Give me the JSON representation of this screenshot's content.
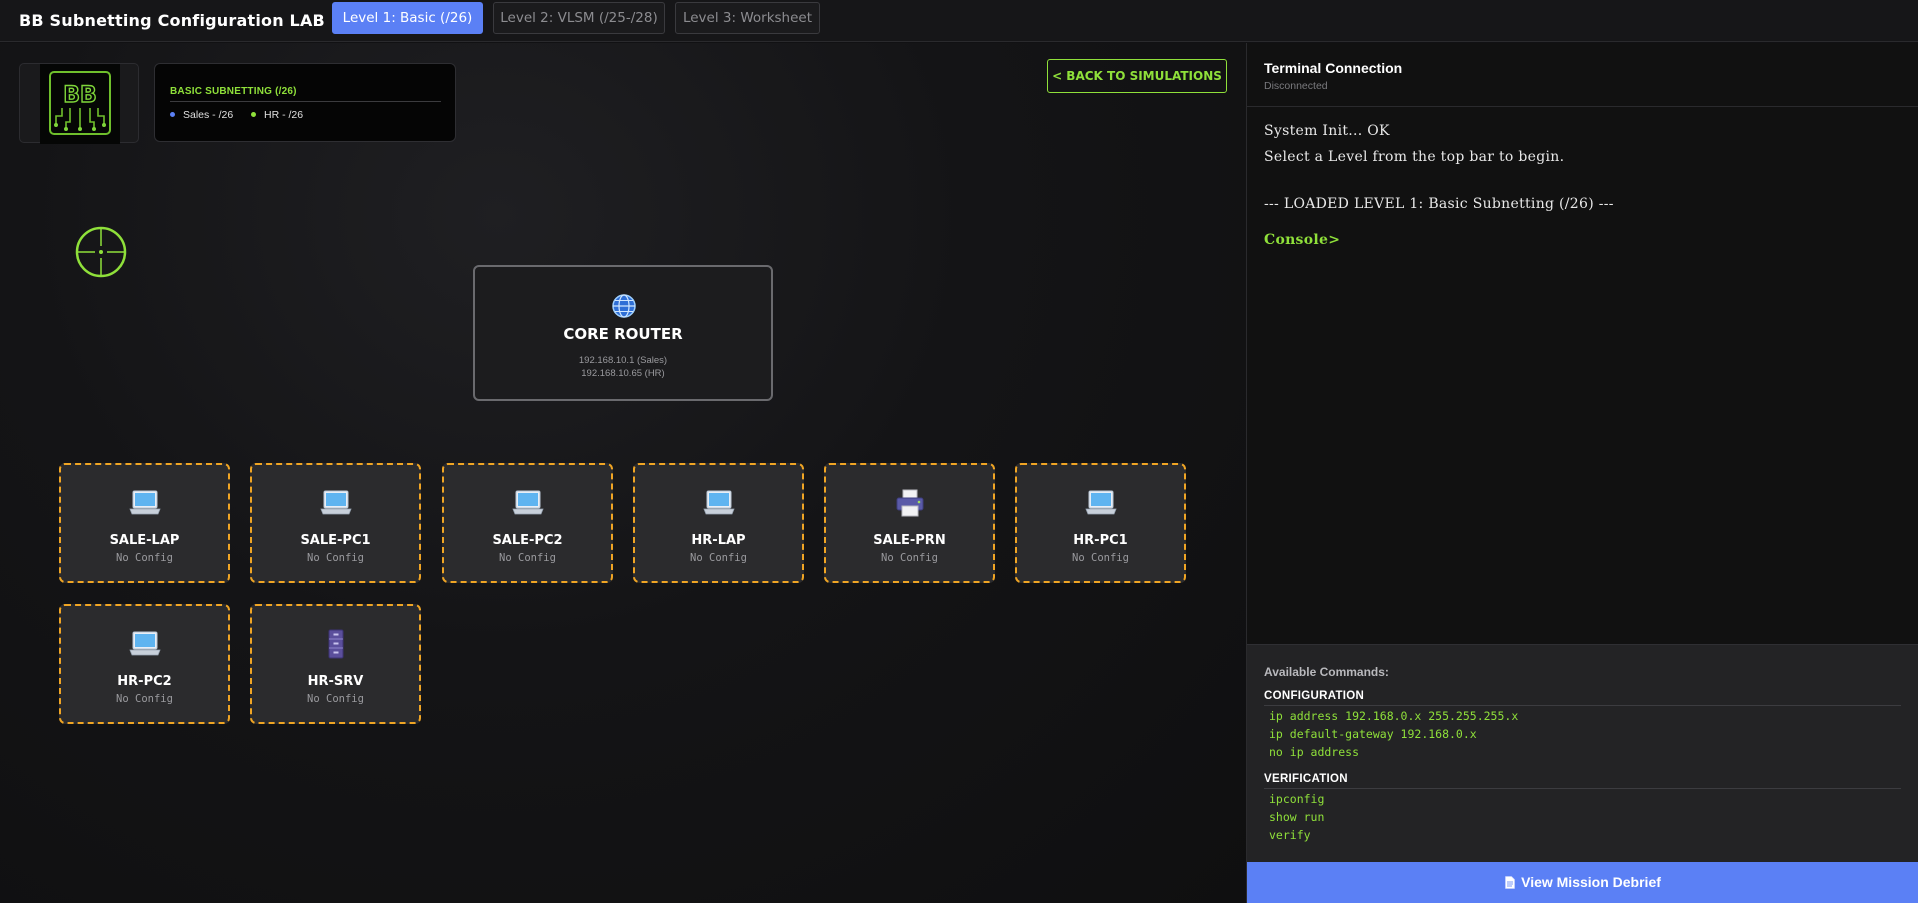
{
  "app": {
    "title": "BB Subnetting Configuration LAB"
  },
  "tabs": [
    {
      "label": "Level 1: Basic (/26)",
      "active": true
    },
    {
      "label": "Level 2: VLSM (/25-/28)",
      "active": false
    },
    {
      "label": "Level 3: Worksheet",
      "active": false
    }
  ],
  "logo": {
    "text": "BB"
  },
  "legend": {
    "title": "BASIC SUBNETTING (/26)",
    "items": [
      {
        "label": "Sales - /26",
        "color": "#5b80f5"
      },
      {
        "label": "HR - /26",
        "color": "#8fe03a"
      }
    ]
  },
  "back_button": {
    "label": "< BACK TO SIMULATIONS"
  },
  "router": {
    "icon": "globe-icon",
    "name": "CORE ROUTER",
    "ips": [
      "192.168.10.1 (Sales)",
      "192.168.10.65 (HR)"
    ]
  },
  "devices": [
    {
      "name": "SALE-LAP",
      "status": "No Config",
      "icon": "laptop-icon"
    },
    {
      "name": "SALE-PC1",
      "status": "No Config",
      "icon": "laptop-icon"
    },
    {
      "name": "SALE-PC2",
      "status": "No Config",
      "icon": "laptop-icon"
    },
    {
      "name": "HR-LAP",
      "status": "No Config",
      "icon": "laptop-icon"
    },
    {
      "name": "SALE-PRN",
      "status": "No Config",
      "icon": "printer-icon"
    },
    {
      "name": "HR-PC1",
      "status": "No Config",
      "icon": "laptop-icon"
    },
    {
      "name": "HR-PC2",
      "status": "No Config",
      "icon": "laptop-icon"
    },
    {
      "name": "HR-SRV",
      "status": "No Config",
      "icon": "server-icon"
    }
  ],
  "terminal": {
    "title": "Terminal Connection",
    "status": "Disconnected",
    "lines": [
      "System Init... OK",
      "Select a Level from the top bar to begin.",
      "--- LOADED LEVEL 1: Basic Subnetting (/26) ---"
    ],
    "prompt": "Console>"
  },
  "commands": {
    "heading": "Available Commands:",
    "sections": [
      {
        "title": "CONFIGURATION",
        "items": [
          "ip address 192.168.0.x 255.255.255.x",
          "ip default-gateway 192.168.0.x",
          "no ip address"
        ]
      },
      {
        "title": "VERIFICATION",
        "items": [
          "ipconfig",
          "show run",
          "verify"
        ]
      }
    ]
  },
  "debrief_button": {
    "label": "View Mission Debrief",
    "icon": "document-icon"
  },
  "colors": {
    "accent_blue": "#5b80f5",
    "accent_green": "#8fe03a",
    "warning_orange": "#f0a524"
  }
}
